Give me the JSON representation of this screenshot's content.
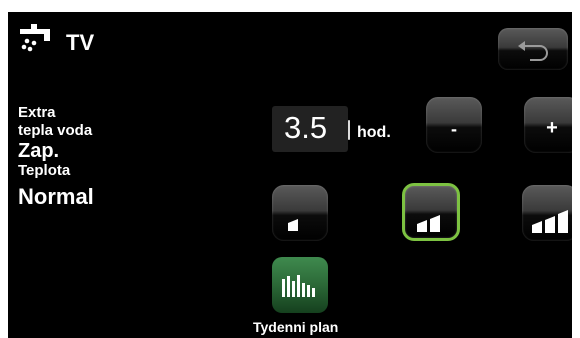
{
  "header": {
    "title": "TV",
    "icon": "faucet-icon"
  },
  "extra_hot_water": {
    "label_line1": "Extra",
    "label_line2": "tepla voda",
    "value": "Zap."
  },
  "temperature": {
    "label": "Teplota",
    "value": "Normal"
  },
  "duration": {
    "value": "3.5",
    "unit": "hod."
  },
  "buttons": {
    "minus": "-",
    "plus": "+",
    "back_icon": "back-arrow-icon"
  },
  "levels": {
    "selected": 2,
    "options": [
      "level-1-icon",
      "level-2-icon",
      "level-3-icon"
    ]
  },
  "schedule": {
    "label": "Tydenni plan",
    "icon": "weekly-plan-icon"
  },
  "colors": {
    "background": "#000000",
    "text": "#ffffff",
    "selected_border": "#7dc242",
    "schedule_green": "#2c6a38"
  }
}
